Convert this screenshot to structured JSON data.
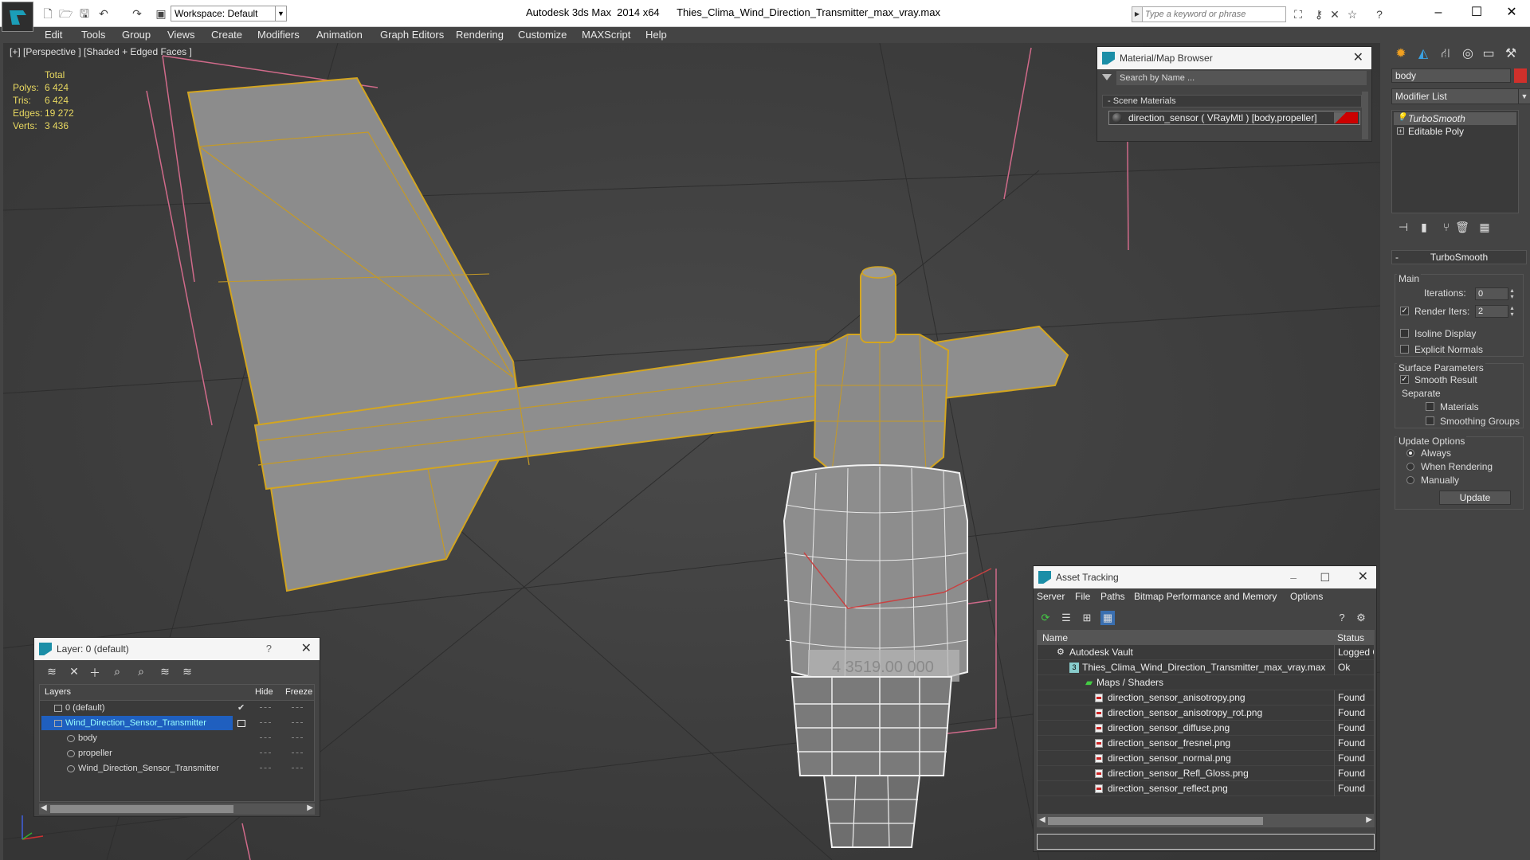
{
  "titlebar": {
    "workspace_label": "Workspace: Default",
    "app_title": "Autodesk 3ds Max  2014 x64",
    "file_title": "Thies_Clima_Wind_Direction_Transmitter_max_vray.max",
    "search_placeholder": "Type a keyword or phrase"
  },
  "menu": [
    "Edit",
    "Tools",
    "Group",
    "Views",
    "Create",
    "Modifiers",
    "Animation",
    "Graph Editors",
    "Rendering",
    "Customize",
    "MAXScript",
    "Help"
  ],
  "viewport": {
    "label": "[+] [Perspective ] [Shaded + Edged Faces ]",
    "stats": {
      "header": "Total",
      "rows": [
        {
          "label": "Polys:",
          "value": "6 424"
        },
        {
          "label": "Tris:",
          "value": "6 424"
        },
        {
          "label": "Edges:",
          "value": "19 272"
        },
        {
          "label": "Verts:",
          "value": "3 436"
        }
      ]
    },
    "decal_text": "4 3519.00 000"
  },
  "material_browser": {
    "title": "Material/Map Browser",
    "search_placeholder": "Search by Name ...",
    "section": "- Scene Materials",
    "entry": "direction_sensor ( VRayMtl ) [body,propeller]",
    "swatch_color": "#cc0000"
  },
  "command_panel": {
    "object_name": "body",
    "object_color": "#d0302b",
    "modifier_list": "Modifier List",
    "stack": [
      "TurboSmooth",
      "Editable Poly"
    ],
    "rollout_title": "TurboSmooth",
    "main_label": "Main",
    "iterations_label": "Iterations:",
    "iterations_value": "0",
    "render_iters_label": "Render Iters:",
    "render_iters_value": "2",
    "render_iters_checked": true,
    "isoline_label": "Isoline Display",
    "explicit_normals_label": "Explicit Normals",
    "surface_label": "Surface Parameters",
    "smooth_result_label": "Smooth Result",
    "separate_label": "Separate",
    "materials_label": "Materials",
    "smoothing_groups_label": "Smoothing Groups",
    "update_options_label": "Update Options",
    "always_label": "Always",
    "when_rendering_label": "When Rendering",
    "manually_label": "Manually",
    "update_button": "Update"
  },
  "layer_panel": {
    "title": "Layer: 0 (default)",
    "help": "?",
    "columns": [
      "Layers",
      "Hide",
      "Freeze"
    ],
    "rows": [
      {
        "name": "0 (default)",
        "level": 0,
        "checked": true
      },
      {
        "name": "Wind_Direction_Sensor_Transmitter",
        "level": 0,
        "selected": true
      },
      {
        "name": "body",
        "level": 1
      },
      {
        "name": "propeller",
        "level": 1
      },
      {
        "name": "Wind_Direction_Sensor_Transmitter",
        "level": 1
      }
    ]
  },
  "asset_tracking": {
    "title": "Asset Tracking",
    "menu": [
      "Server",
      "File",
      "Paths",
      "Bitmap Performance and Memory",
      "Options"
    ],
    "columns": [
      "Name",
      "Status"
    ],
    "rows": [
      {
        "name": "Autodesk Vault",
        "status": "Logged O",
        "level": 1,
        "icon": "vault"
      },
      {
        "name": "Thies_Clima_Wind_Direction_Transmitter_max_vray.max",
        "status": "Ok",
        "level": 2,
        "icon": "max"
      },
      {
        "name": "Maps / Shaders",
        "status": "",
        "level": 3,
        "icon": "maps"
      },
      {
        "name": "direction_sensor_anisotropy.png",
        "status": "Found",
        "level": 4,
        "icon": "png"
      },
      {
        "name": "direction_sensor_anisotropy_rot.png",
        "status": "Found",
        "level": 4,
        "icon": "png"
      },
      {
        "name": "direction_sensor_diffuse.png",
        "status": "Found",
        "level": 4,
        "icon": "png"
      },
      {
        "name": "direction_sensor_fresnel.png",
        "status": "Found",
        "level": 4,
        "icon": "png"
      },
      {
        "name": "direction_sensor_normal.png",
        "status": "Found",
        "level": 4,
        "icon": "png"
      },
      {
        "name": "direction_sensor_Refl_Gloss.png",
        "status": "Found",
        "level": 4,
        "icon": "png"
      },
      {
        "name": "direction_sensor_reflect.png",
        "status": "Found",
        "level": 4,
        "icon": "png"
      }
    ]
  }
}
